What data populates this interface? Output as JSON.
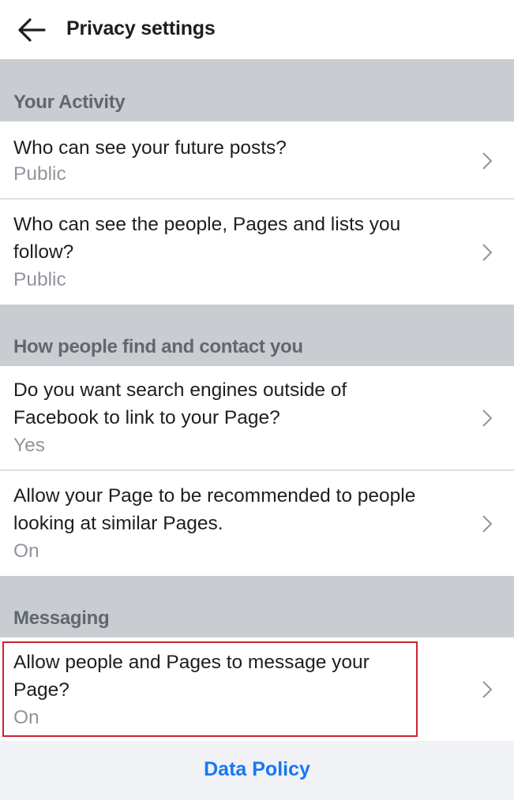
{
  "header": {
    "title": "Privacy settings",
    "back_icon": "arrow-left-icon"
  },
  "sections": [
    {
      "title": "Your Activity",
      "items": [
        {
          "question": "Who can see your future posts?",
          "value": "Public"
        },
        {
          "question": "Who can see the people, Pages and lists you follow?",
          "value": "Public"
        }
      ]
    },
    {
      "title": "How people find and contact you",
      "items": [
        {
          "question": "Do you want search engines outside of Facebook to link to your Page?",
          "value": "Yes"
        },
        {
          "question": "Allow your Page to be recommended to people looking at similar Pages.",
          "value": "On"
        }
      ]
    },
    {
      "title": "Messaging",
      "items": [
        {
          "question": "Allow people and Pages to message your Page?",
          "value": "On",
          "highlighted": true
        }
      ]
    }
  ],
  "footer": {
    "link_label": "Data Policy"
  },
  "colors": {
    "accent": "#1877f2",
    "highlight_border": "#d0212e",
    "section_bg": "#c9ccd1"
  }
}
